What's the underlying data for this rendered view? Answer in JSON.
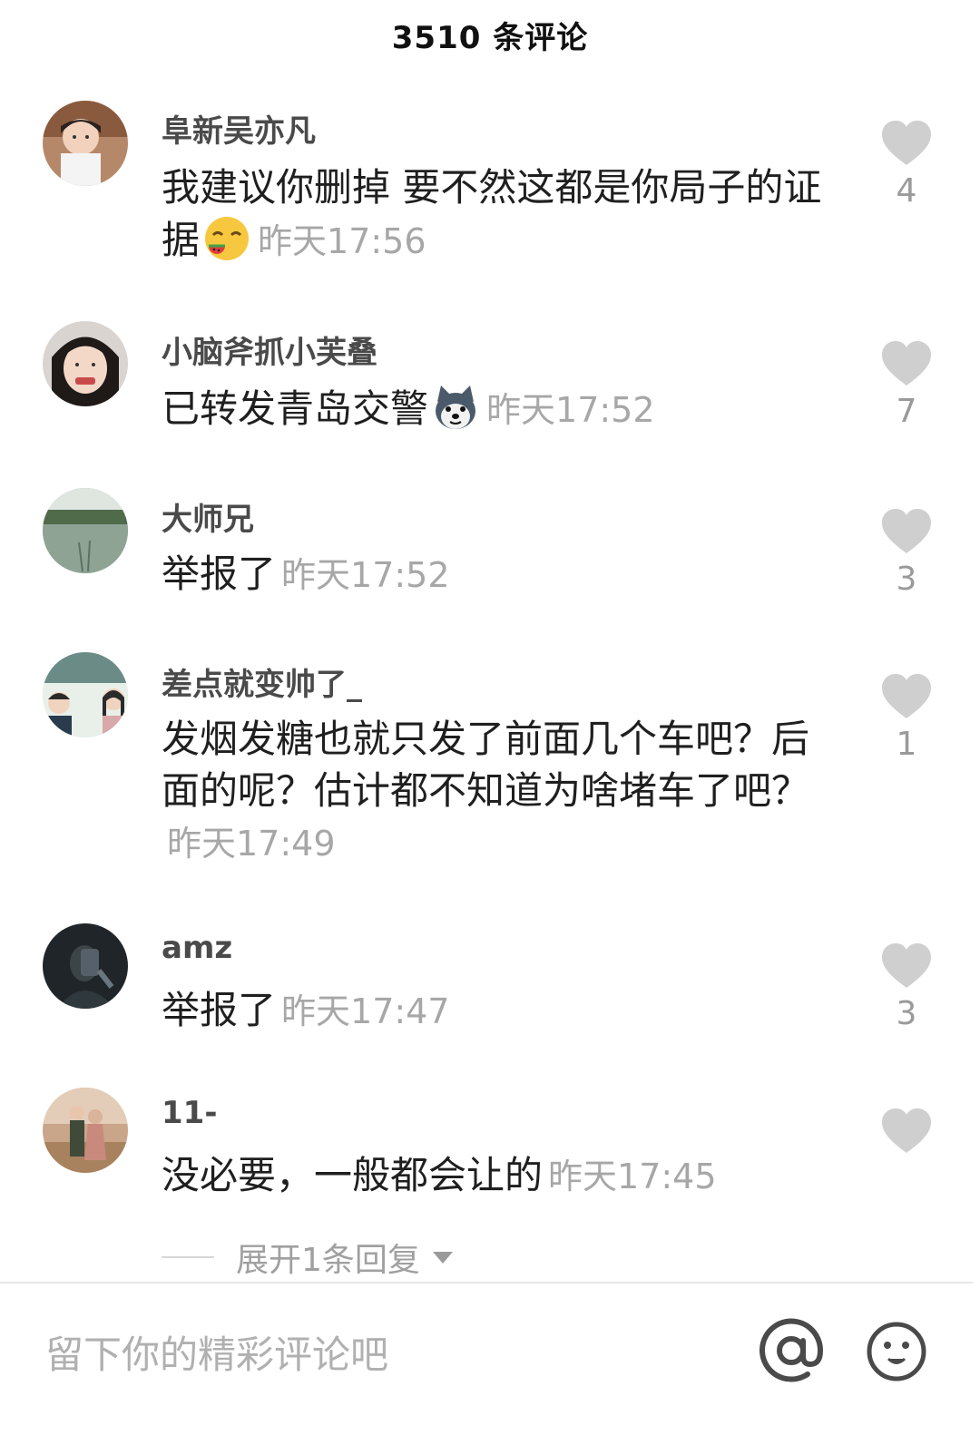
{
  "header": {
    "title": "3510 条评论"
  },
  "comments": [
    {
      "username": "阜新吴亦凡",
      "text": "我建议你删掉 要不然这都是你局子的证据",
      "emoji": "watermelon-face-emoji",
      "time": "昨天17:56",
      "likes": "4"
    },
    {
      "username": "小脑斧抓小芙叠",
      "text": "已转发青岛交警",
      "emoji": "husky-dog-emoji",
      "time": "昨天17:52",
      "likes": "7"
    },
    {
      "username": "大师兄",
      "text": "举报了",
      "time": "昨天17:52",
      "likes": "3"
    },
    {
      "username": "差点就变帅了_",
      "text": "发烟发糖也就只发了前面几个车吧？后面的呢？估计都不知道为啥堵车了吧？",
      "time": "昨天17:49",
      "likes": "1"
    },
    {
      "username": "amz",
      "text": "举报了",
      "time": "昨天17:47",
      "likes": "3"
    },
    {
      "username": "11-",
      "text": "没必要，一般都会让的",
      "time": "昨天17:45",
      "likes": ""
    }
  ],
  "expand_replies": {
    "label": "展开1条回复"
  },
  "input_bar": {
    "placeholder": "留下你的精彩评论吧",
    "at_icon": "at-sign-icon",
    "emoji_icon": "smiley-icon"
  },
  "colors": {
    "like_heart": "#cfcfcf",
    "timestamp": "#a7a7a7",
    "username": "#4a4a4a"
  }
}
